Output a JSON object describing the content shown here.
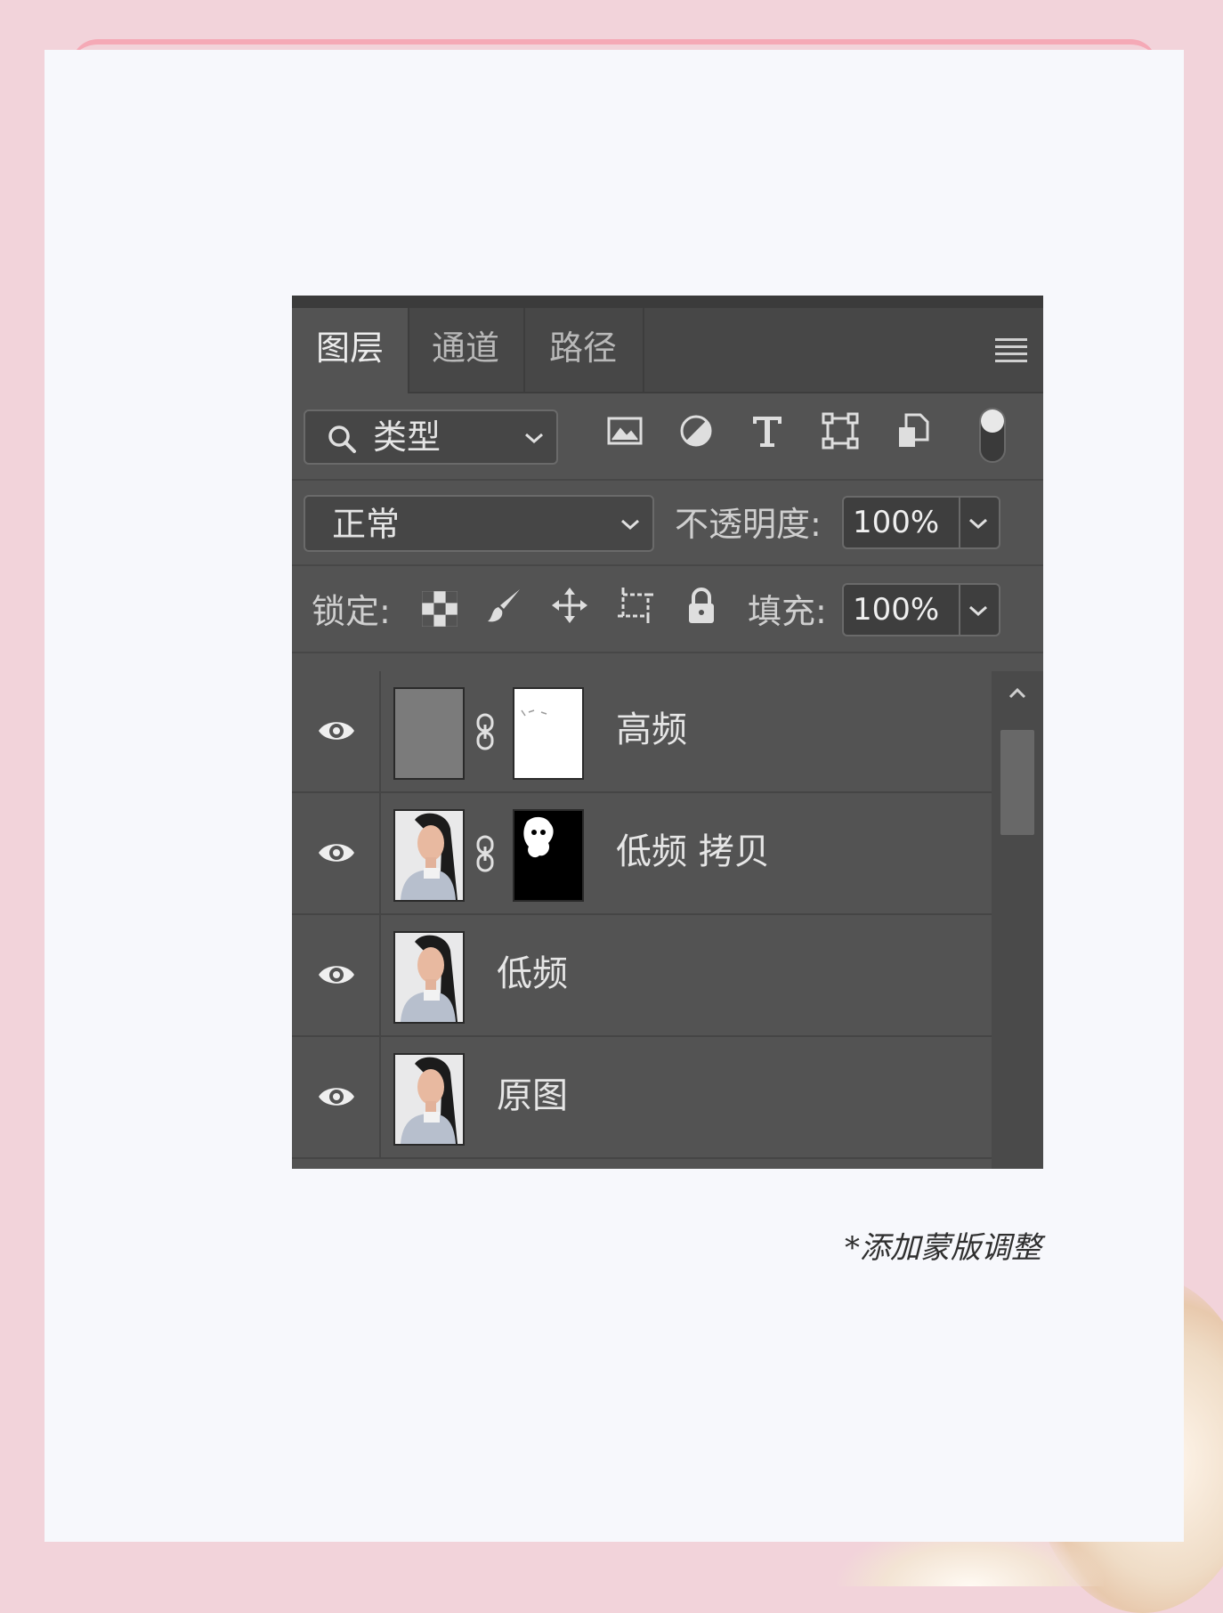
{
  "panel": {
    "tabs": [
      {
        "label": "图层",
        "active": true
      },
      {
        "label": "通道",
        "active": false
      },
      {
        "label": "路径",
        "active": false
      }
    ],
    "filter": {
      "icon": "search-icon",
      "value": "类型"
    },
    "filter_icons": [
      "image-filter-icon",
      "adjustment-filter-icon",
      "text-filter-icon",
      "shape-filter-icon",
      "smart-object-filter-icon",
      "filter-toggle-icon"
    ],
    "blend_mode": "正常",
    "opacity": {
      "label": "不透明度:",
      "value": "100%"
    },
    "lock": {
      "label": "锁定:",
      "icons": [
        "lock-transparent-icon",
        "lock-image-icon",
        "lock-position-icon",
        "lock-artboard-icon",
        "lock-all-icon"
      ]
    },
    "fill": {
      "label": "填充:",
      "value": "100%"
    },
    "layers": [
      {
        "name": "高频",
        "visible": true,
        "has_mask": true,
        "thumb": "gray",
        "mask": "white"
      },
      {
        "name": "低频 拷贝",
        "visible": true,
        "has_mask": true,
        "thumb": "portrait",
        "mask": "black"
      },
      {
        "name": "低频",
        "visible": true,
        "has_mask": false,
        "thumb": "portrait"
      },
      {
        "name": "原图",
        "visible": true,
        "has_mask": false,
        "thumb": "portrait"
      }
    ]
  },
  "caption": "*添加蒙版调整",
  "colors": {
    "panel_bg": "#535353",
    "tab_bar": "#474747",
    "page_bg": "#f2d3da",
    "card_bg": "#f7f8fc"
  }
}
